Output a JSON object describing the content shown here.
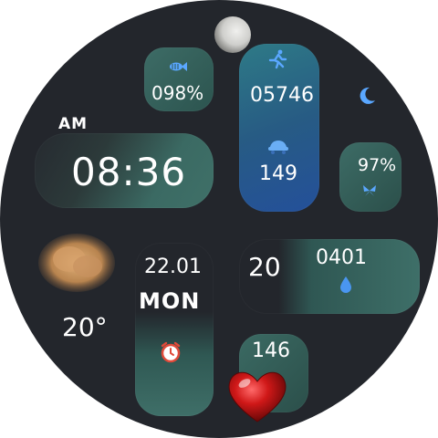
{
  "battery": {
    "value": "098%",
    "icon": "battery-fish-icon"
  },
  "steps": {
    "value": "05746",
    "icon": "running-man-icon"
  },
  "calories": {
    "value": "149",
    "icon": "cart-icon"
  },
  "moon": {
    "icon": "moon-phase-icon",
    "crescent_icon": "crescent-moon-icon"
  },
  "ampm": "AM",
  "time": "08:36",
  "humidity": {
    "value": "97%",
    "icon": "butterfly-icon"
  },
  "weather": {
    "temp": "20°",
    "icon": "weather-cloud-icon"
  },
  "date": {
    "day": "22.01",
    "weekday": "MON"
  },
  "alarm": {
    "icon": "alarm-clock-icon"
  },
  "extra": {
    "left": "20",
    "right": "0401",
    "icon": "water-drop-icon"
  },
  "heart": {
    "value": "146",
    "icon": "heart-icon"
  },
  "colors": {
    "accent": "#3f6e67",
    "blue": "#2a5ea8",
    "bg": "#23262c"
  }
}
